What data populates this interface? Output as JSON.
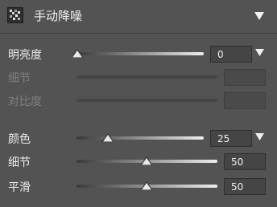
{
  "header": {
    "title": "手动降噪",
    "icon": "noise-pattern-icon",
    "collapse_icon": "triangle-down-icon"
  },
  "luminance": {
    "label": "明亮度",
    "value": "0",
    "slider": 0
  },
  "lum_detail": {
    "label": "细节",
    "value": "",
    "enabled": false
  },
  "lum_contrast": {
    "label": "对比度",
    "value": "",
    "enabled": false
  },
  "color": {
    "label": "颜色",
    "value": "25",
    "slider": 0.25
  },
  "color_detail": {
    "label": "细节",
    "value": "50",
    "slider": 0.5
  },
  "smoothness": {
    "label": "平滑",
    "value": "50",
    "slider": 0.5
  },
  "colors": {
    "background": "#535353",
    "track_light": "#ededed",
    "track_dark": "#3a3a3a"
  }
}
